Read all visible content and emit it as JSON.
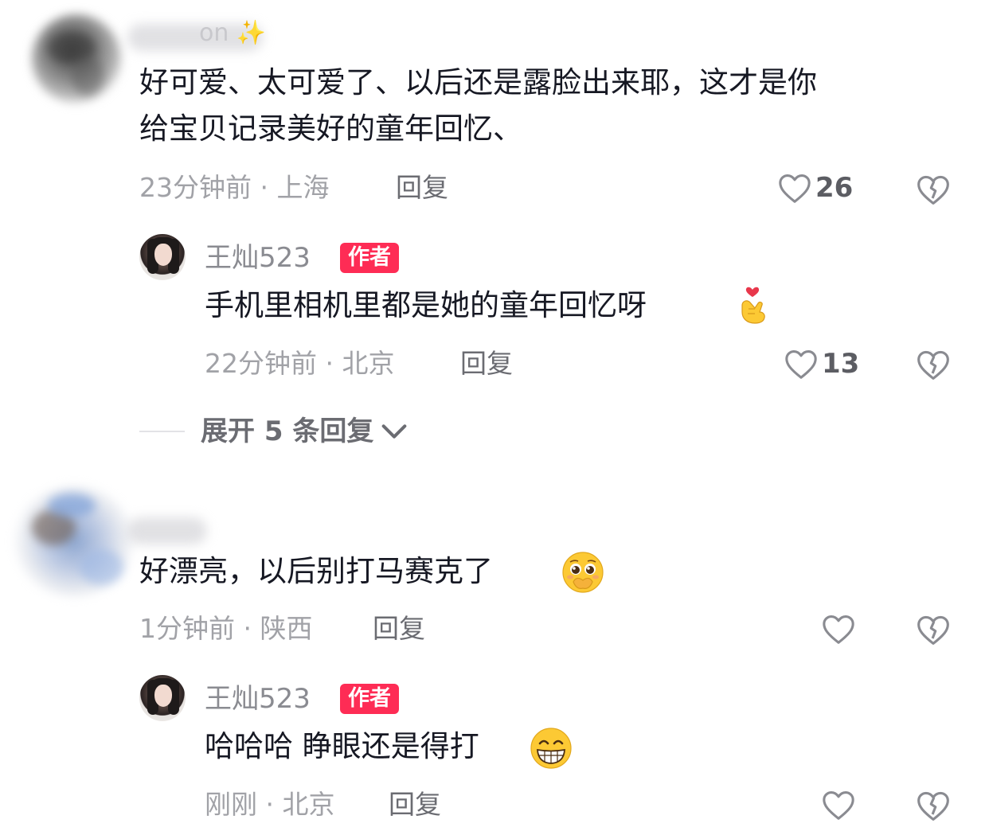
{
  "comments": [
    {
      "username_hint": "on ✨",
      "text_line1": "好可爱、太可爱了、以后还是露脸出来耶，这才是你",
      "text_line2": "给宝贝记录美好的童年回忆、",
      "meta": "23分钟前 · 上海",
      "reply_label": "回复",
      "likes": "26",
      "replies": [
        {
          "author": "王灿523",
          "badge": "作者",
          "text": "手机里相机里都是她的童年回忆呀",
          "emoji": "finger-heart-icon",
          "meta": "22分钟前 · 北京",
          "reply_label": "回复",
          "likes": "13"
        }
      ],
      "expand_label": "展开 5 条回复"
    },
    {
      "username_hint": "",
      "text": "好漂亮，以后别打马赛克了",
      "emoji": "pleading-face-icon",
      "meta": "1分钟前 · 陕西",
      "reply_label": "回复",
      "likes": "",
      "replies": [
        {
          "author": "王灿523",
          "badge": "作者",
          "text": "哈哈哈 睁眼还是得打",
          "emoji": "grinning-face-icon",
          "meta": "刚刚 · 北京",
          "reply_label": "回复",
          "likes": ""
        }
      ]
    }
  ],
  "colors": {
    "badge": "#fe2c55",
    "meta": "#a1a2a7",
    "text": "#161823",
    "icon": "#8a8b91"
  }
}
